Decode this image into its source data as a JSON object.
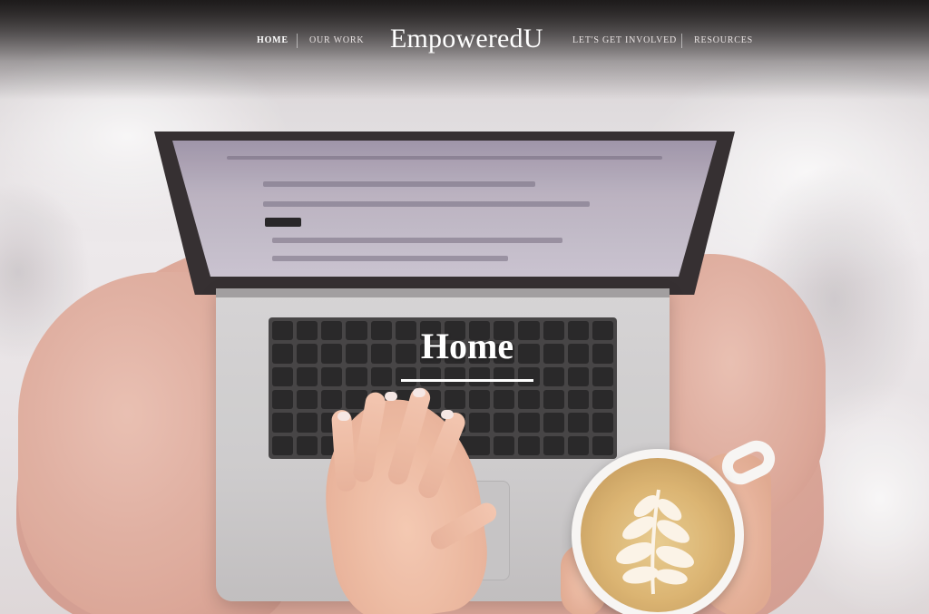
{
  "nav": {
    "items": [
      {
        "label": "HOME",
        "active": true
      },
      {
        "label": "OUR WORK",
        "active": false
      },
      {
        "label": "LET'S GET INVOLVED",
        "active": false
      },
      {
        "label": "RESOURCES",
        "active": false
      }
    ],
    "brand": "EmpoweredU"
  },
  "hero": {
    "title": "Home",
    "image_description_icon": "laptop-coffee-photo"
  },
  "colors": {
    "nav_text": "#e9e3e3",
    "nav_active": "#ffffff",
    "title": "#ffffff",
    "top_shade": "#141212"
  }
}
